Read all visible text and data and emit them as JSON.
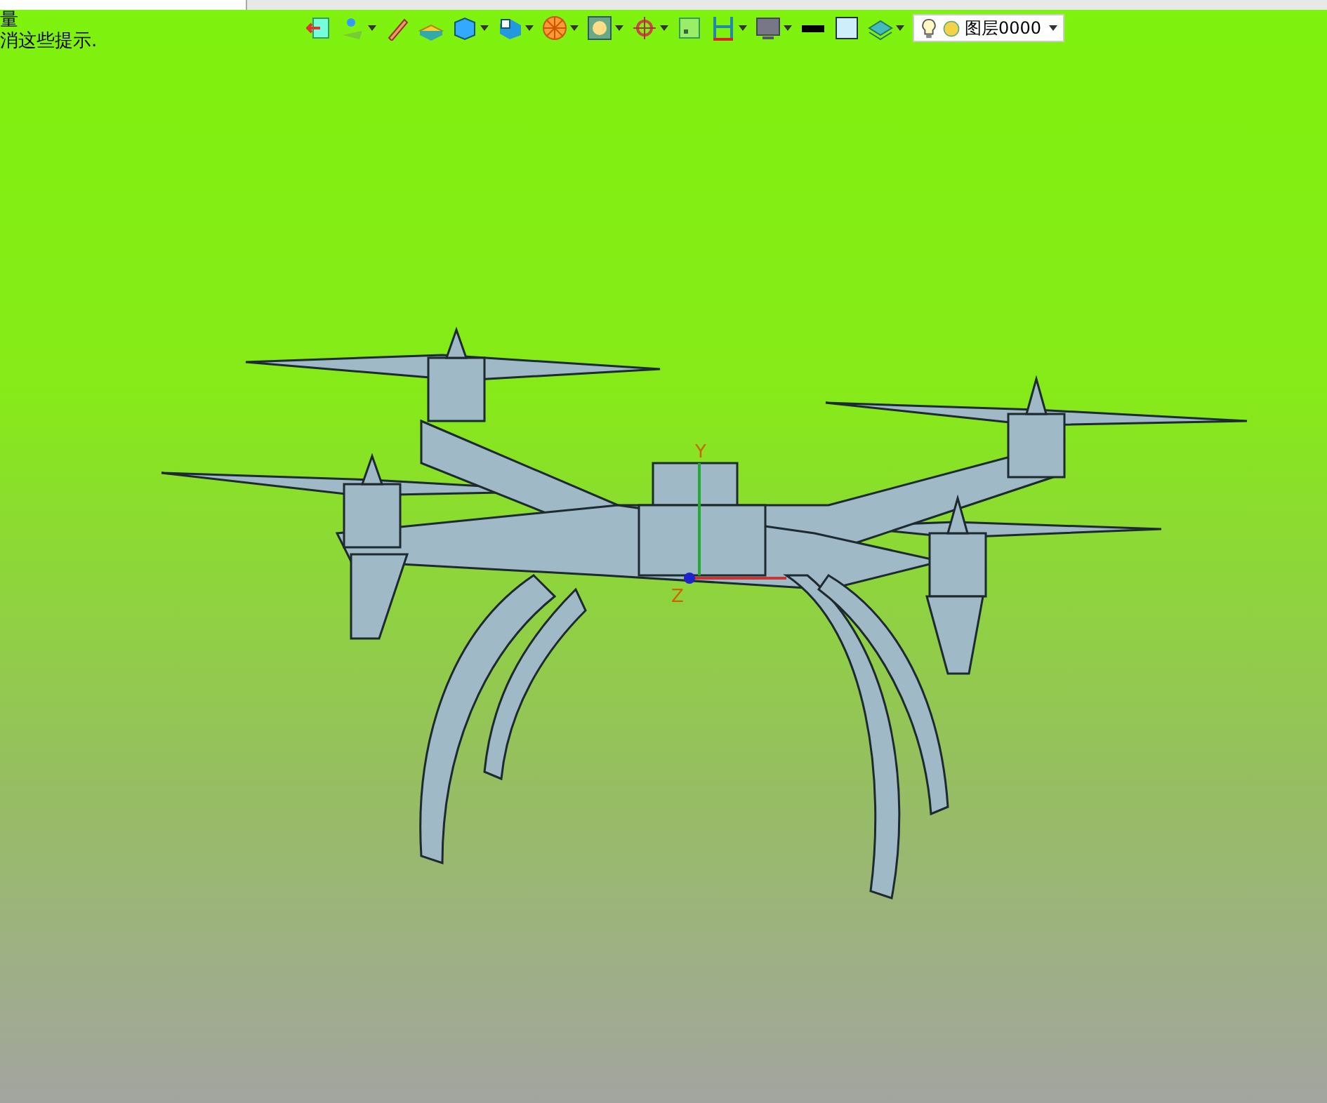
{
  "hint_lines": [
    "量",
    "消这些提示."
  ],
  "toolbar": [
    {
      "kind": "exit",
      "dropdown": false
    },
    {
      "kind": "sketch",
      "dropdown": true
    },
    {
      "kind": "pen",
      "dropdown": false
    },
    {
      "kind": "extrude",
      "dropdown": false
    },
    {
      "kind": "cube",
      "dropdown": true
    },
    {
      "kind": "view",
      "dropdown": true
    },
    {
      "kind": "wheel",
      "dropdown": true
    },
    {
      "kind": "frame",
      "dropdown": true
    },
    {
      "kind": "target",
      "dropdown": true
    },
    {
      "kind": "square",
      "dropdown": false
    },
    {
      "kind": "measure",
      "dropdown": true
    },
    {
      "kind": "monitor",
      "dropdown": true
    },
    {
      "kind": "line",
      "dropdown": false
    },
    {
      "kind": "fill",
      "dropdown": false
    },
    {
      "kind": "layers",
      "dropdown": true
    }
  ],
  "layer_select": {
    "value": "图层0000"
  },
  "axis_labels": [
    "Y",
    "Z"
  ]
}
